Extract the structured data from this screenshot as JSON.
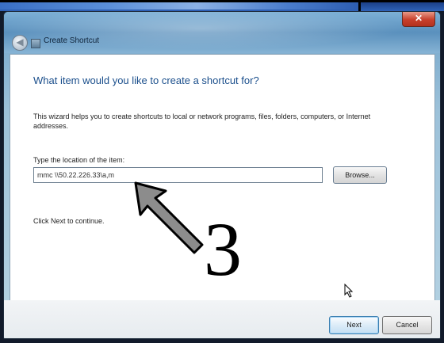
{
  "window": {
    "title": "Create Shortcut",
    "close_glyph": "✕",
    "back_glyph": "◀",
    "icons": {
      "back": "back-arrow-icon",
      "title": "shortcut-icon",
      "close": "close-icon"
    }
  },
  "wizard": {
    "heading": "What item would you like to create a shortcut for?",
    "description": "This wizard helps you to create shortcuts to local or network programs, files, folders, computers, or Internet addresses.",
    "location_label": "Type the location of the item:",
    "location_value": "mmc \\\\50.22.226.33\\a,m",
    "browse_label": "Browse...",
    "continue_text": "Click Next to continue."
  },
  "footer": {
    "next_label": "Next",
    "cancel_label": "Cancel"
  },
  "annotation": {
    "step_number": "3",
    "icons": {
      "arrow": "annotation-arrow-icon",
      "cursor": "mouse-cursor-icon"
    }
  },
  "colors": {
    "heading": "#1b4f8c",
    "close_button": "#c8402c",
    "title_bar": "#6fa3c9"
  }
}
